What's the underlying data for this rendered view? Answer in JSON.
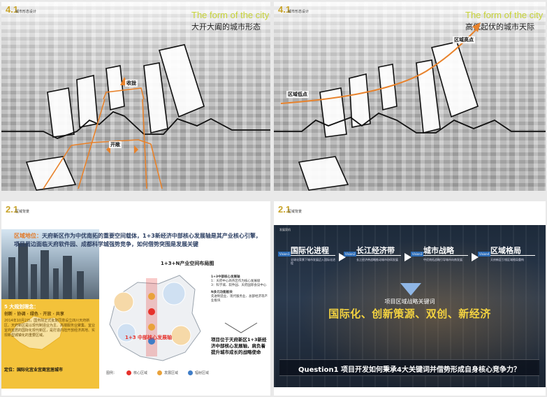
{
  "slide1": {
    "section_number": "4.1",
    "section_caption": "城市形态设计",
    "title_en": "The form of the city",
    "title_cn": "大开大阖的城市形态",
    "tags": {
      "close": "收拢",
      "open": "开敞"
    }
  },
  "slide2": {
    "section_number": "4.1",
    "section_caption": "城市形态设计",
    "title_en": "The form of the city",
    "title_cn": "高低起伏的城市天际",
    "tags": {
      "regional_peak": "区域高点",
      "regional_base": "区域低点"
    }
  },
  "slide3": {
    "section_number": "2.1",
    "section_caption": "区域背景",
    "headline_lead": "区域地位：",
    "headline_text": "天府新区作为中优南拓的重要空间载体，1+3新经济中部核心发展轴是其产业核心引擎，项目周边面临天府软件园、成都科学城强势竞争，如何借势突围是发展关键",
    "block_title": "5 大规划理念：",
    "block_keywords": "创新 · 协调 · 绿色 · 开放 · 共享",
    "block_text": "2014年10月2日，国务院正式批复同意设立四川天府新区。天府新区是以现代制造业为主、高端服务业聚集、宜业宜商宜居的国际化现代新区，是打造内陆开放经济高地、实现新型城镇化的重要区域。",
    "block_position": "定位：国际化宜业宜商宜居城市",
    "diagram_title": "1+3+N产业空间布局图",
    "red_label": "1+3 中部核心发展轴",
    "notes": [
      "1+3中部核心发展轴",
      "1：天府中心商务区作为核心发展极",
      "3：科学城、软件园、天府国际会议中心",
      "N多元功能板块",
      "先进制造业、现代服务业、总部经济等产业板块"
    ],
    "conclusion": "项目位于天府新区1+3新经济中部核心发展轴，肩负着提升城市成长的战略使命",
    "legend_label": "图例：",
    "legend": [
      {
        "label": "核心区域",
        "color": "#e6312b"
      },
      {
        "label": "发展区域",
        "color": "#e9a23b"
      },
      {
        "label": "辐射区域",
        "color": "#3f7dc7"
      }
    ]
  },
  "slide4": {
    "section_number": "2.1",
    "section_caption": "区域背景",
    "tag": "发展契机",
    "keywords": [
      {
        "vision": "Vision1",
        "title": "国际化进程",
        "desc": "全球化背景下城市发展迈入国际化进程"
      },
      {
        "vision": "Vision2",
        "title": "长江经济带",
        "desc": "长江经济带战略推动城市协同发展"
      },
      {
        "vision": "Vision3",
        "title": "城市战略",
        "desc": "中优南拓战略引导城市向南发展"
      },
      {
        "vision": "Vision4",
        "title": "区域格局",
        "desc": "天府新区引领区域格局重构"
      }
    ],
    "keyword_label": "项目区域战略关键词",
    "keyword_big": "国际化、创新策源、双创、新经济",
    "question": "Question1  项目开发如何秉承4大关键词并借势形成自身核心竞争力？"
  },
  "colors": {
    "gold": "#c9a42a",
    "lime": "#c7d339",
    "orange": "#e8822b",
    "yellow_panel": "#f3c23a",
    "red": "#e6312b",
    "dark_bg": "#1d2a3a"
  }
}
